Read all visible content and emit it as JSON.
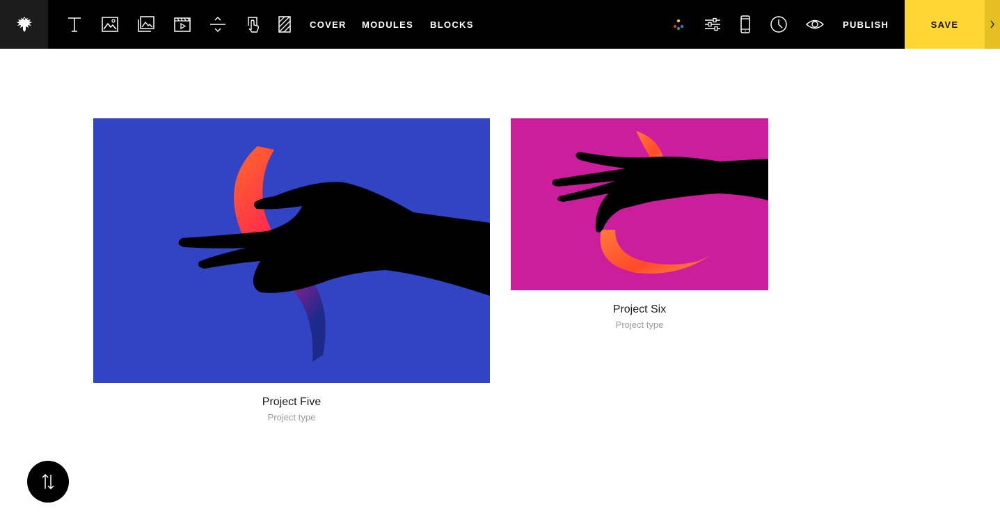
{
  "toolbar": {
    "logo_icon": "eagle-emblem-icon",
    "tools": [
      "text-icon",
      "image-icon",
      "gallery-icon",
      "video-icon",
      "spacer-icon",
      "button-icon",
      "grid-icon"
    ],
    "nav": {
      "cover": "COVER",
      "modules": "MODULES",
      "blocks": "BLOCKS"
    },
    "right_tools": [
      "colors-icon",
      "settings-sliders-icon",
      "mobile-icon",
      "history-clock-icon",
      "preview-eye-icon"
    ],
    "publish_label": "PUBLISH",
    "save_label": "SAVE",
    "accent_color": "#ffd633"
  },
  "projects": [
    {
      "title": "Project Five",
      "type": "Project type",
      "bg_color": "#3044c4"
    },
    {
      "title": "Project Six",
      "type": "Project type",
      "bg_color": "#cc1e9c"
    }
  ],
  "fab": {
    "icon": "reorder-arrows-icon"
  }
}
